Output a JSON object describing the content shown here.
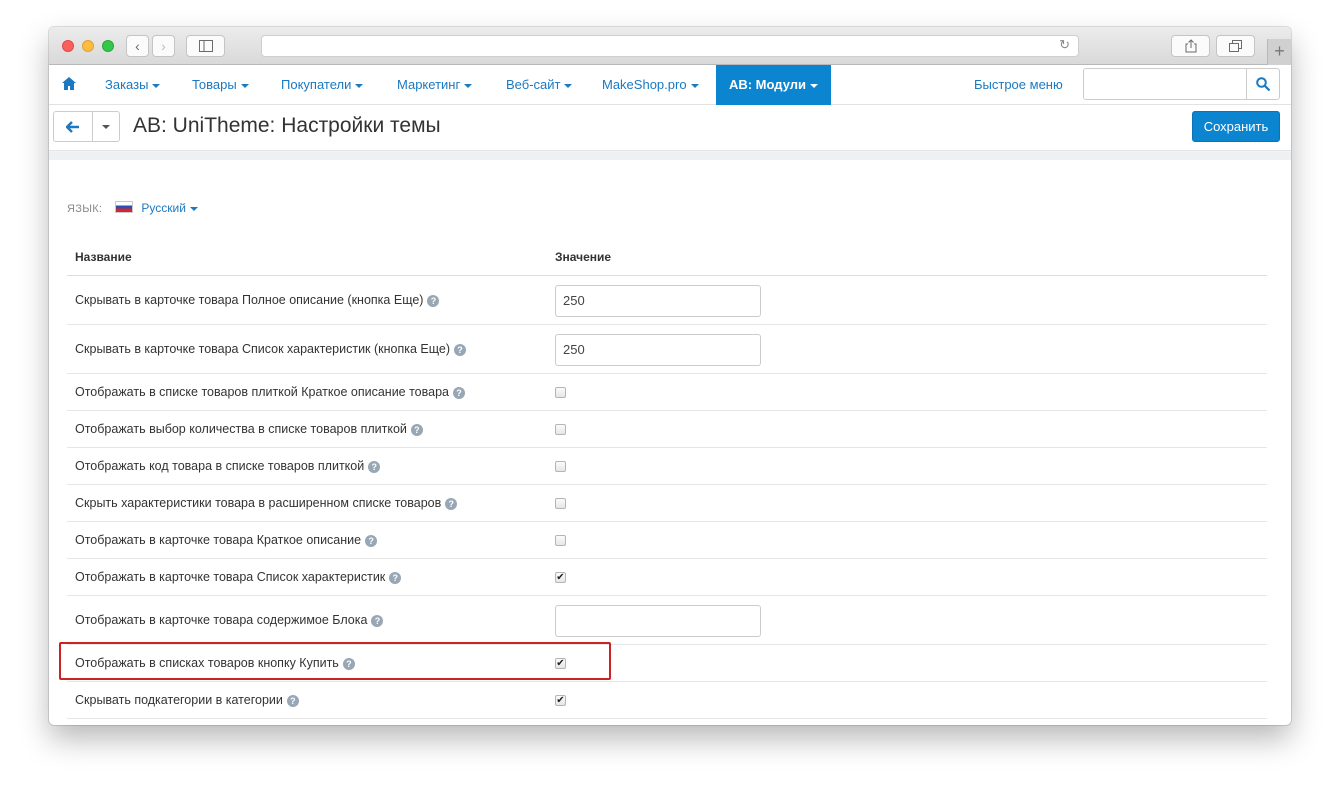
{
  "nav": {
    "items": [
      {
        "label": "Заказы"
      },
      {
        "label": "Товары"
      },
      {
        "label": "Покупатели"
      },
      {
        "label": "Маркетинг"
      },
      {
        "label": "Веб-сайт"
      },
      {
        "label": "MakeShop.pro"
      },
      {
        "label": "AB: Модули"
      }
    ],
    "quick_menu": "Быстрое меню",
    "search_placeholder": ""
  },
  "page": {
    "title": "AB: UniTheme: Настройки темы",
    "save_label": "Сохранить"
  },
  "language": {
    "label": "ЯЗЫК:",
    "selected": "Русский"
  },
  "table": {
    "col_name": "Название",
    "col_value": "Значение",
    "rows": [
      {
        "label": "Скрывать в карточке товара Полное описание (кнопка Еще)",
        "type": "text",
        "value": "250"
      },
      {
        "label": "Скрывать в карточке товара Список характеристик (кнопка Еще)",
        "type": "text",
        "value": "250"
      },
      {
        "label": "Отображать в списке товаров плиткой Краткое описание товара",
        "type": "checkbox",
        "checked": false
      },
      {
        "label": "Отображать выбор количества в списке товаров плиткой",
        "type": "checkbox",
        "checked": false
      },
      {
        "label": "Отображать код товара в списке товаров плиткой",
        "type": "checkbox",
        "checked": false
      },
      {
        "label": "Скрыть характеристики товара в расширенном списке товаров",
        "type": "checkbox",
        "checked": false
      },
      {
        "label": "Отображать в карточке товара Краткое описание",
        "type": "checkbox",
        "checked": false
      },
      {
        "label": "Отображать в карточке товара Список характеристик",
        "type": "checkbox",
        "checked": true
      },
      {
        "label": "Отображать в карточке товара содержимое Блока",
        "type": "text",
        "value": ""
      },
      {
        "label": "Отображать в списках товаров кнопку Купить",
        "type": "checkbox",
        "checked": true
      },
      {
        "label": "Скрывать подкатегории в категории",
        "type": "checkbox",
        "checked": true
      }
    ]
  },
  "colors": {
    "accent": "#0c85d0",
    "link": "#1b79c1",
    "highlight_border": "#cc2222"
  }
}
